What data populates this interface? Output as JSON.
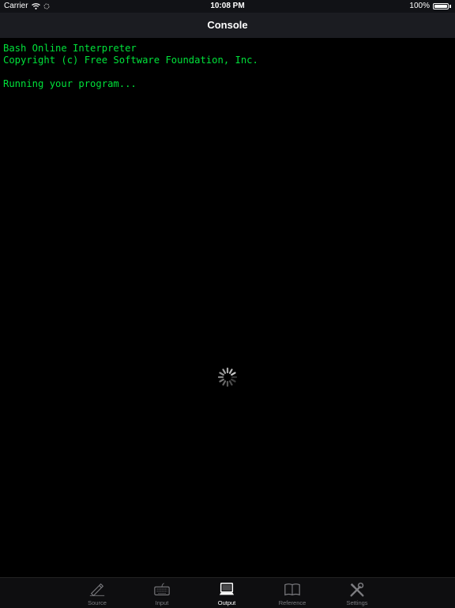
{
  "status_bar": {
    "carrier": "Carrier",
    "time": "10:08 PM",
    "battery_text": "100%",
    "battery_level": 1.0,
    "wifi_icon": "wifi-icon",
    "activity_icon": "activity-icon"
  },
  "nav": {
    "title": "Console"
  },
  "console": {
    "lines": [
      "Bash Online Interpreter",
      "Copyright (c) Free Software Foundation, Inc.",
      "",
      "Running your program..."
    ]
  },
  "loading": {
    "icon": "spinner-icon"
  },
  "tab_bar": {
    "tabs": [
      {
        "label": "Source",
        "icon": "pen-icon",
        "active": false
      },
      {
        "label": "Input",
        "icon": "keyboard-icon",
        "active": false
      },
      {
        "label": "Output",
        "icon": "monitor-icon",
        "active": true
      },
      {
        "label": "Reference",
        "icon": "book-icon",
        "active": false
      },
      {
        "label": "Settings",
        "icon": "tools-icon",
        "active": false
      }
    ]
  },
  "colors": {
    "console_text": "#00e23a",
    "background": "#000000",
    "tab_active": "#ffffff",
    "tab_inactive": "#7c7c80"
  }
}
